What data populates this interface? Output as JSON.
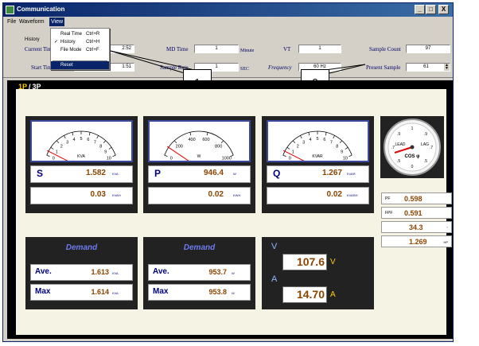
{
  "window": {
    "title": "Communication",
    "min_glyph": "_",
    "max_glyph": "□",
    "close_glyph": "X"
  },
  "menu": {
    "items": [
      "File",
      "Waveform",
      "View"
    ],
    "view_dropdown": [
      {
        "label": "Real Time",
        "shortcut": "Ctrl+R",
        "checked": false
      },
      {
        "label": "History",
        "shortcut": "Ctrl+H",
        "checked": true
      },
      {
        "label": "File Mode",
        "shortcut": "Ctrl+F",
        "checked": false
      },
      {
        "label": "Reset",
        "shortcut": "",
        "checked": false
      }
    ],
    "check_mark": "✓"
  },
  "header": {
    "history_tag": "History",
    "current_time_label": "Current Tim",
    "current_time_value": "2:52",
    "start_time_label": "Start Time",
    "start_time_value": "1:51",
    "md_time_label": "MD Time",
    "md_time_value": "1",
    "md_time_unit": "Minute",
    "sample_rate_label": "Sample Rate",
    "sample_rate_value": "1",
    "sample_rate_unit": "SEC",
    "vt_label": "VT",
    "vt_value": "1",
    "frequency_label": "Frequency",
    "frequency_value": "60 Hz",
    "sample_count_label": "Sample Count",
    "sample_count_value": "97",
    "present_sample_label": "Present Sample",
    "present_sample_value": "61"
  },
  "callouts": [
    "1",
    "2"
  ],
  "mode": {
    "phase_1": "1P",
    "separator": "/",
    "phase_3": "3P"
  },
  "meters": [
    {
      "name": "S",
      "unit_label": "KVA",
      "ticks": [
        "0",
        "1",
        "2",
        "3",
        "4",
        "5",
        "6",
        "7",
        "8",
        "9",
        "10"
      ],
      "needle_fraction": 0.05
    },
    {
      "name": "P",
      "unit_label": "W",
      "ticks": [
        "0",
        "200",
        "400",
        "600",
        "800",
        "1000"
      ],
      "needle_fraction": 0.1
    },
    {
      "name": "Q",
      "unit_label": "KVAR",
      "ticks": [
        "0",
        "1",
        "2",
        "3",
        "4",
        "5",
        "6",
        "7",
        "8",
        "9",
        "10"
      ],
      "needle_fraction": 0.05
    }
  ],
  "readings": {
    "s": {
      "symbol": "S",
      "value": "1.582",
      "unit": "KVA"
    },
    "s_energy": {
      "value": "0.03",
      "unit": "KVAH"
    },
    "p": {
      "symbol": "P",
      "value": "946.4",
      "unit": "W"
    },
    "p_energy": {
      "value": "0.02",
      "unit": "KWH"
    },
    "q": {
      "symbol": "Q",
      "value": "1.267",
      "unit": "KVAR"
    },
    "q_energy": {
      "value": "0.02",
      "unit": "KVARH"
    }
  },
  "pf_gauge": {
    "lead_label": "LEAD",
    "lag_label": "LAG",
    "cos_label": "COS φ",
    "ticks": [
      ".9",
      "1",
      ".9",
      ".7",
      ".5",
      "0",
      ".5",
      ".7"
    ]
  },
  "side": {
    "pf": {
      "label": "PF",
      "value": "0.598"
    },
    "fpf": {
      "label": "FPF",
      "value": "0.591"
    },
    "angle": {
      "value": "34.3",
      "unit": "°"
    },
    "hp": {
      "value": "1.269",
      "unit": "HP"
    }
  },
  "demand_kva": {
    "title": "Demand",
    "ave_label": "Ave.",
    "ave_value": "1.613",
    "ave_unit": "KVA",
    "max_label": "Max",
    "max_value": "1.614",
    "max_unit": "KVA"
  },
  "demand_w": {
    "title": "Demand",
    "ave_label": "Ave.",
    "ave_value": "953.7",
    "ave_unit": "W",
    "max_label": "Max",
    "max_value": "953.8",
    "max_unit": "W"
  },
  "va": {
    "v_label": "V",
    "v_value": "107.6",
    "v_unit": "V",
    "a_label": "A",
    "a_value": "14.70",
    "a_unit": "A"
  },
  "colors": {
    "accent_yellow": "#ffcc00",
    "value_brown": "#8b4500",
    "label_navy": "#000080",
    "needle_red": "#e00000",
    "demand_blue": "#6c7cf0"
  }
}
